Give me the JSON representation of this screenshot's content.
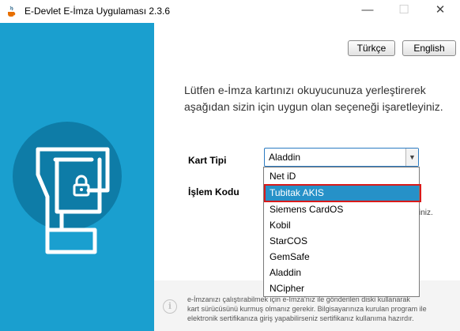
{
  "window": {
    "title": "E-Devlet E-İmza Uygulaması 2.3.6",
    "minimize_glyph": "—",
    "maximize_glyph": "☐",
    "close_glyph": "✕"
  },
  "colors": {
    "accent_blue": "#1a9fcf",
    "selected_item": "#2691c8",
    "highlight_border": "#d91a1a"
  },
  "icons": {
    "app": "java-cup-icon",
    "card_reader": "card-reader-icon",
    "info": "info-icon"
  },
  "language": {
    "turkish_label": "Türkçe",
    "english_label": "English"
  },
  "instructions": "Lütfen e-İmza kartınızı okuyucunuza yerleştirerek aşağıdan sizin için uygun olan seçeneği işaretleyiniz.",
  "form": {
    "card_type_label": "Kart Tipi",
    "transaction_code_label": "İşlem Kodu",
    "card_type_value": "Aladdin",
    "partial_text": "iniz."
  },
  "dropdown": {
    "selected_index": 1,
    "options": [
      "Net iD",
      "Tubitak AKIS",
      "Siemens CardOS",
      "Kobil",
      "StarCOS",
      "GemSafe",
      "Aladdin",
      "NCipher"
    ]
  },
  "info": {
    "line1": "e-İmzanızı çalıştırabilmek için e-İmza'nız ile gönderilen diski kullanarak",
    "line2": "kart sürücüsünü kurmuş olmanız gerekir. Bilgisayarınıza kurulan program ile",
    "line3": "elektronik sertifikanıza giriş yapabilirseniz sertifikanız kullanıma hazırdır."
  }
}
